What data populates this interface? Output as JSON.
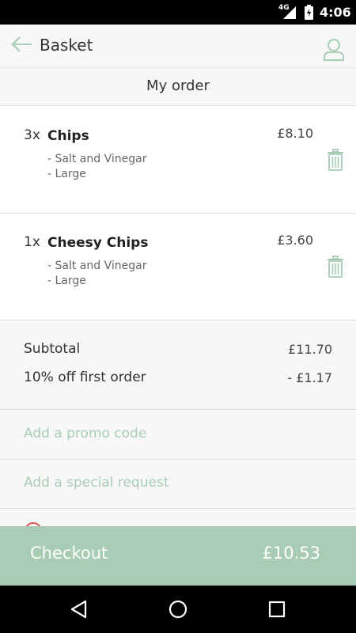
{
  "status_bar": {
    "network": "4G",
    "time": "4:06",
    "icons": [
      "signal-icon",
      "battery-icon"
    ]
  },
  "app_bar": {
    "title": "Basket",
    "icons": [
      "back-arrow-icon",
      "user-icon"
    ]
  },
  "section": {
    "title": "My order"
  },
  "order_items": [
    {
      "qty": "3x",
      "name": "Chips",
      "options": [
        "- Salt and Vinegar",
        "- Large"
      ],
      "price": "£8.10"
    },
    {
      "qty": "1x",
      "name": "Cheesy Chips",
      "options": [
        "- Salt and Vinegar",
        "- Large"
      ],
      "price": "£3.60"
    }
  ],
  "summary": {
    "subtotal_label": "Subtotal",
    "subtotal_value": "£11.70",
    "discount_label": "10% off first order",
    "discount_value": "- £1.17"
  },
  "links": {
    "promo": "Add a promo code",
    "special_request": "Add a special request"
  },
  "checkout": {
    "label": "Checkout",
    "total": "£10.53"
  },
  "colors": {
    "accent": "#a9ccb4",
    "accent_text": "#a8cdb5",
    "background": "#f7f7f7"
  }
}
